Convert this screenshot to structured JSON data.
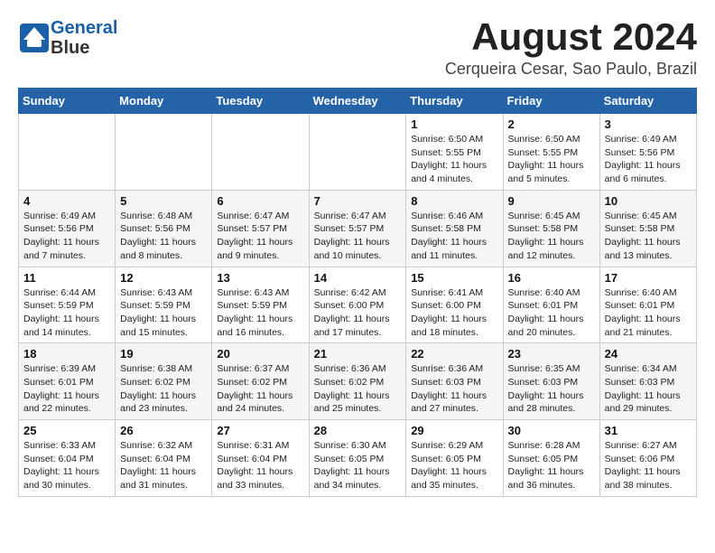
{
  "logo": {
    "line1": "General",
    "line2": "Blue"
  },
  "title": "August 2024",
  "location": "Cerqueira Cesar, Sao Paulo, Brazil",
  "weekdays": [
    "Sunday",
    "Monday",
    "Tuesday",
    "Wednesday",
    "Thursday",
    "Friday",
    "Saturday"
  ],
  "weeks": [
    [
      {
        "day": "",
        "detail": ""
      },
      {
        "day": "",
        "detail": ""
      },
      {
        "day": "",
        "detail": ""
      },
      {
        "day": "",
        "detail": ""
      },
      {
        "day": "1",
        "detail": "Sunrise: 6:50 AM\nSunset: 5:55 PM\nDaylight: 11 hours\nand 4 minutes."
      },
      {
        "day": "2",
        "detail": "Sunrise: 6:50 AM\nSunset: 5:55 PM\nDaylight: 11 hours\nand 5 minutes."
      },
      {
        "day": "3",
        "detail": "Sunrise: 6:49 AM\nSunset: 5:56 PM\nDaylight: 11 hours\nand 6 minutes."
      }
    ],
    [
      {
        "day": "4",
        "detail": "Sunrise: 6:49 AM\nSunset: 5:56 PM\nDaylight: 11 hours\nand 7 minutes."
      },
      {
        "day": "5",
        "detail": "Sunrise: 6:48 AM\nSunset: 5:56 PM\nDaylight: 11 hours\nand 8 minutes."
      },
      {
        "day": "6",
        "detail": "Sunrise: 6:47 AM\nSunset: 5:57 PM\nDaylight: 11 hours\nand 9 minutes."
      },
      {
        "day": "7",
        "detail": "Sunrise: 6:47 AM\nSunset: 5:57 PM\nDaylight: 11 hours\nand 10 minutes."
      },
      {
        "day": "8",
        "detail": "Sunrise: 6:46 AM\nSunset: 5:58 PM\nDaylight: 11 hours\nand 11 minutes."
      },
      {
        "day": "9",
        "detail": "Sunrise: 6:45 AM\nSunset: 5:58 PM\nDaylight: 11 hours\nand 12 minutes."
      },
      {
        "day": "10",
        "detail": "Sunrise: 6:45 AM\nSunset: 5:58 PM\nDaylight: 11 hours\nand 13 minutes."
      }
    ],
    [
      {
        "day": "11",
        "detail": "Sunrise: 6:44 AM\nSunset: 5:59 PM\nDaylight: 11 hours\nand 14 minutes."
      },
      {
        "day": "12",
        "detail": "Sunrise: 6:43 AM\nSunset: 5:59 PM\nDaylight: 11 hours\nand 15 minutes."
      },
      {
        "day": "13",
        "detail": "Sunrise: 6:43 AM\nSunset: 5:59 PM\nDaylight: 11 hours\nand 16 minutes."
      },
      {
        "day": "14",
        "detail": "Sunrise: 6:42 AM\nSunset: 6:00 PM\nDaylight: 11 hours\nand 17 minutes."
      },
      {
        "day": "15",
        "detail": "Sunrise: 6:41 AM\nSunset: 6:00 PM\nDaylight: 11 hours\nand 18 minutes."
      },
      {
        "day": "16",
        "detail": "Sunrise: 6:40 AM\nSunset: 6:01 PM\nDaylight: 11 hours\nand 20 minutes."
      },
      {
        "day": "17",
        "detail": "Sunrise: 6:40 AM\nSunset: 6:01 PM\nDaylight: 11 hours\nand 21 minutes."
      }
    ],
    [
      {
        "day": "18",
        "detail": "Sunrise: 6:39 AM\nSunset: 6:01 PM\nDaylight: 11 hours\nand 22 minutes."
      },
      {
        "day": "19",
        "detail": "Sunrise: 6:38 AM\nSunset: 6:02 PM\nDaylight: 11 hours\nand 23 minutes."
      },
      {
        "day": "20",
        "detail": "Sunrise: 6:37 AM\nSunset: 6:02 PM\nDaylight: 11 hours\nand 24 minutes."
      },
      {
        "day": "21",
        "detail": "Sunrise: 6:36 AM\nSunset: 6:02 PM\nDaylight: 11 hours\nand 25 minutes."
      },
      {
        "day": "22",
        "detail": "Sunrise: 6:36 AM\nSunset: 6:03 PM\nDaylight: 11 hours\nand 27 minutes."
      },
      {
        "day": "23",
        "detail": "Sunrise: 6:35 AM\nSunset: 6:03 PM\nDaylight: 11 hours\nand 28 minutes."
      },
      {
        "day": "24",
        "detail": "Sunrise: 6:34 AM\nSunset: 6:03 PM\nDaylight: 11 hours\nand 29 minutes."
      }
    ],
    [
      {
        "day": "25",
        "detail": "Sunrise: 6:33 AM\nSunset: 6:04 PM\nDaylight: 11 hours\nand 30 minutes."
      },
      {
        "day": "26",
        "detail": "Sunrise: 6:32 AM\nSunset: 6:04 PM\nDaylight: 11 hours\nand 31 minutes."
      },
      {
        "day": "27",
        "detail": "Sunrise: 6:31 AM\nSunset: 6:04 PM\nDaylight: 11 hours\nand 33 minutes."
      },
      {
        "day": "28",
        "detail": "Sunrise: 6:30 AM\nSunset: 6:05 PM\nDaylight: 11 hours\nand 34 minutes."
      },
      {
        "day": "29",
        "detail": "Sunrise: 6:29 AM\nSunset: 6:05 PM\nDaylight: 11 hours\nand 35 minutes."
      },
      {
        "day": "30",
        "detail": "Sunrise: 6:28 AM\nSunset: 6:05 PM\nDaylight: 11 hours\nand 36 minutes."
      },
      {
        "day": "31",
        "detail": "Sunrise: 6:27 AM\nSunset: 6:06 PM\nDaylight: 11 hours\nand 38 minutes."
      }
    ]
  ]
}
